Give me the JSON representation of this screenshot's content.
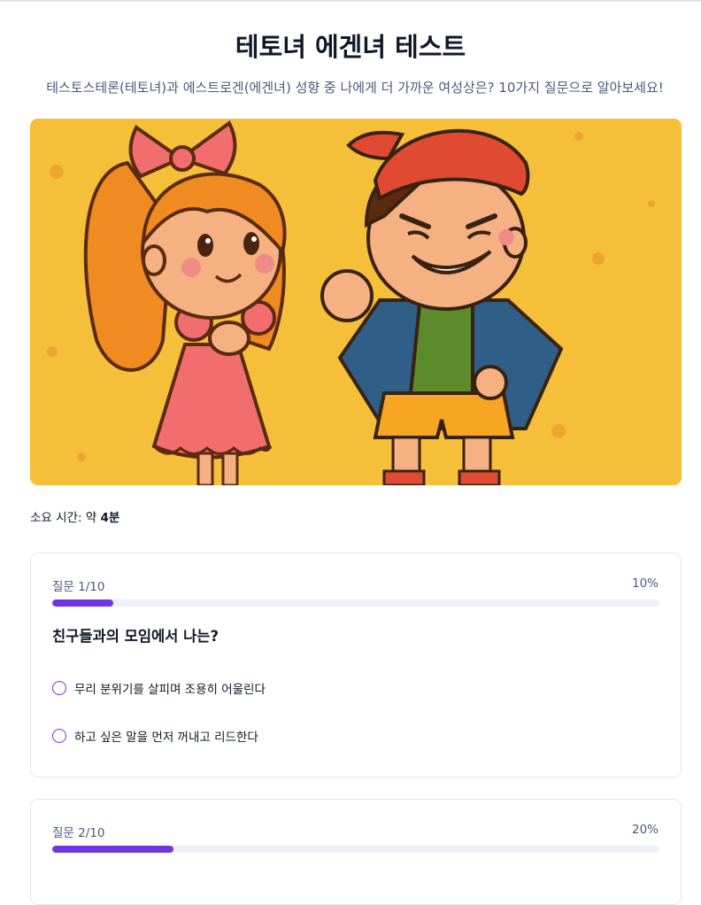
{
  "page": {
    "title": "테토녀 에겐녀 테스트",
    "subtitle": "테스토스테론(테토녀)과 에스트로겐(에겐녀) 성향 중 나에게 더 가까운 여성상은? 10가지 질문으로 알아보세요!"
  },
  "hero": {
    "icon": "illustration-girl-and-boy",
    "bg_color": "#f6bf3a"
  },
  "duration": {
    "label": "소요 시간: 약 ",
    "value": "4분"
  },
  "colors": {
    "accent": "#7234e0",
    "track": "#eef1f7",
    "muted_text": "#4b5a78"
  },
  "questions": [
    {
      "number_label": "질문 1/10",
      "percent_label": "10%",
      "progress": 0.1,
      "text": "친구들과의 모임에서 나는?",
      "options": [
        "무리 분위기를 살피며 조용히 어울린다",
        "하고 싶은 말을 먼저 꺼내고 리드한다"
      ]
    },
    {
      "number_label": "질문 2/10",
      "percent_label": "20%",
      "progress": 0.2
    }
  ]
}
